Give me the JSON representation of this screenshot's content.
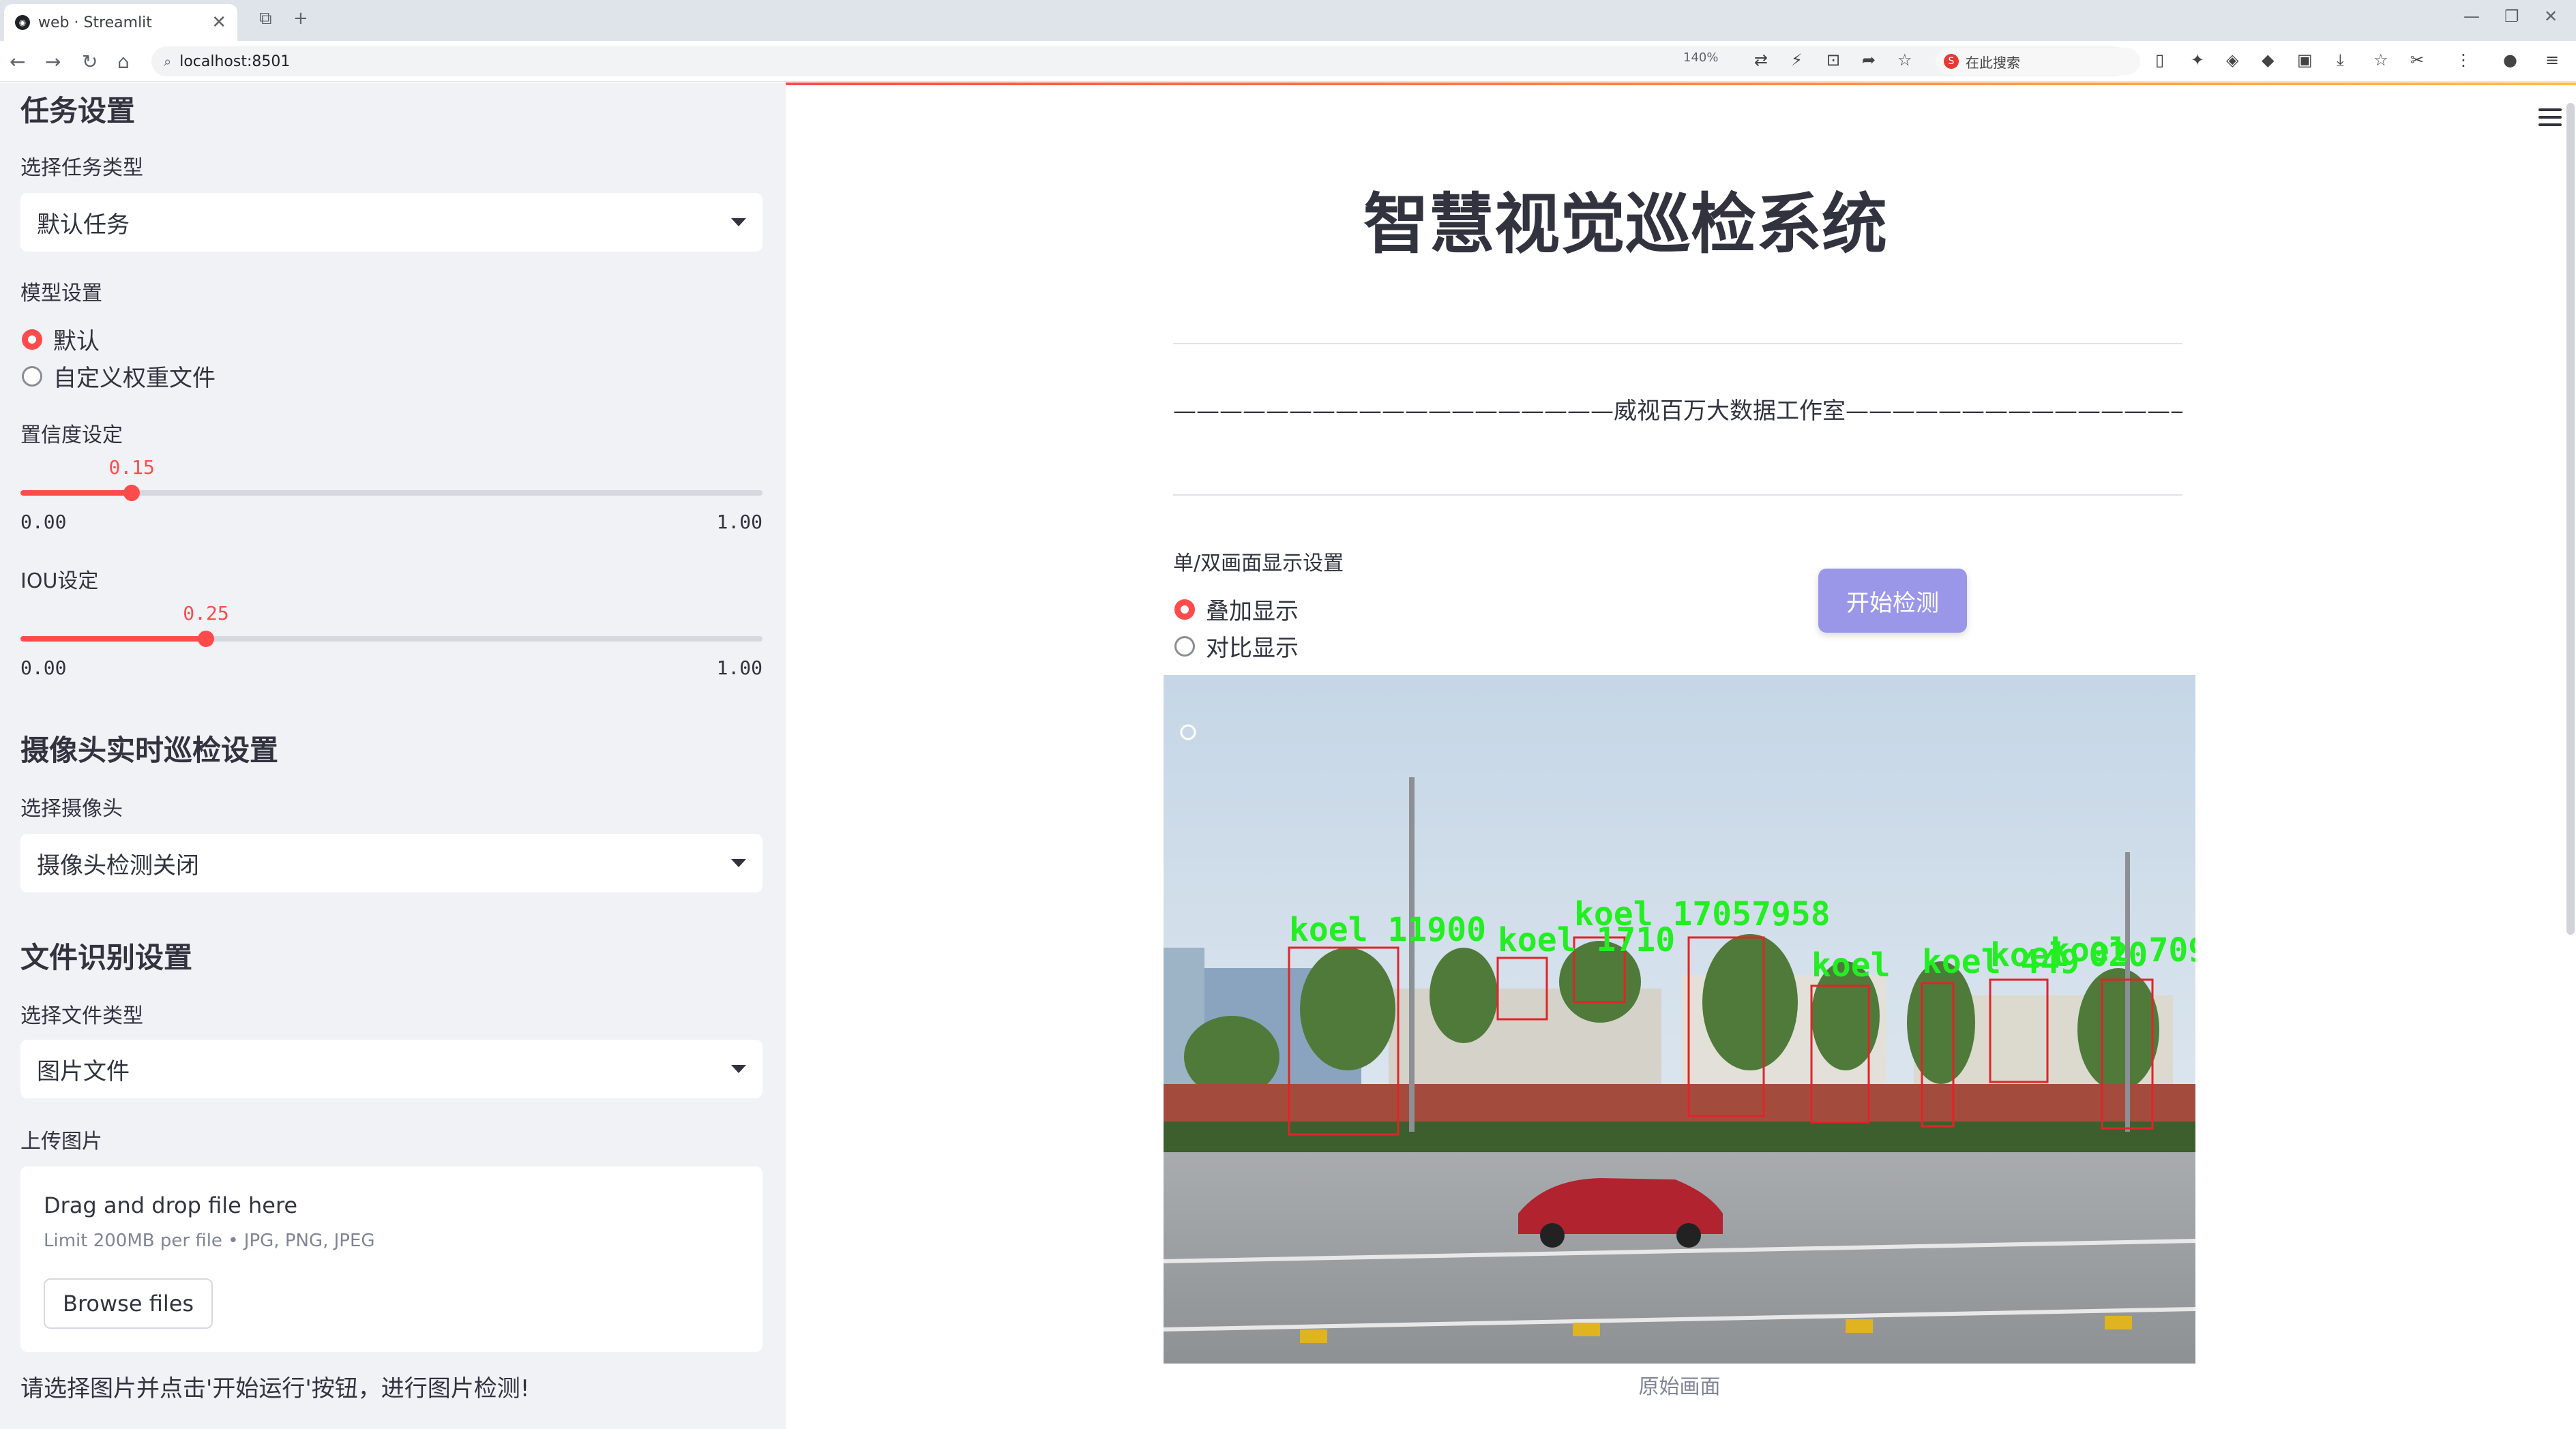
{
  "browser": {
    "tab_title": "web · Streamlit",
    "tab_close": "✕",
    "new_tab": "+",
    "url": "localhost:8501",
    "zoom": "140%",
    "search_placeholder": "在此搜索",
    "search_logo": "S"
  },
  "sidebar": {
    "task_heading": "任务设置",
    "task_type_label": "选择任务类型",
    "task_type_value": "默认任务",
    "model_label": "模型设置",
    "model_options": [
      "默认",
      "自定义权重文件"
    ],
    "model_selected": 0,
    "conf_label": "置信度设定",
    "conf": {
      "value": 0.15,
      "value_text": "0.15",
      "min": "0.00",
      "max": "1.00"
    },
    "iou_label": "IOU设定",
    "iou": {
      "value": 0.25,
      "value_text": "0.25",
      "min": "0.00",
      "max": "1.00"
    },
    "camera_heading": "摄像头实时巡检设置",
    "camera_label": "选择摄像头",
    "camera_value": "摄像头检测关闭",
    "file_heading": "文件识别设置",
    "file_type_label": "选择文件类型",
    "file_type_value": "图片文件",
    "upload_label": "上传图片",
    "uploader": {
      "drag_text": "Drag and drop file here",
      "limit_text": "Limit 200MB per file • JPG, PNG, JPEG",
      "browse_label": "Browse files"
    },
    "note": "请选择图片并点击'开始运行'按钮，进行图片检测!"
  },
  "main": {
    "title": "智慧视觉巡检系统",
    "studio_line": "———————————————————威视百万大数据工作室————————————————————",
    "display_label": "单/双画面显示设置",
    "display_options": [
      "叠加显示",
      "对比显示"
    ],
    "display_selected": 0,
    "start_button": "开始检测",
    "caption": "原始画面",
    "detections": [
      {
        "label": "koel 11900"
      },
      {
        "label": "koel 1710"
      },
      {
        "label": "koel 17057958"
      },
      {
        "label": "koel"
      },
      {
        "label": "koel 449"
      },
      {
        "label": "koel 020"
      },
      {
        "label": "koel 709"
      }
    ]
  },
  "colors": {
    "accent": "#ff4b4b",
    "button": "#9a96e8",
    "sidebar_bg": "#f0f2f6",
    "detection_box": "#e0242a",
    "detection_text": "#22ee22"
  }
}
